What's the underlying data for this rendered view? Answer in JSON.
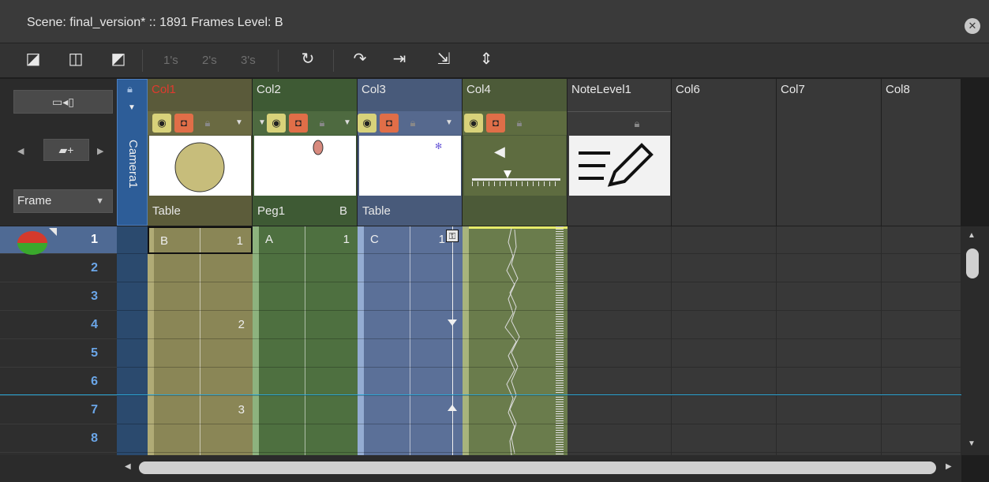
{
  "window": {
    "title": "Scene: final_version*  ::  1891 Frames  Level: B",
    "close_icon": "close-icon"
  },
  "toolbar": {
    "steps": [
      "1's",
      "2's",
      "3's"
    ]
  },
  "left_panel": {
    "frame_mode": "Frame"
  },
  "camera_column": {
    "label": "Camera1"
  },
  "columns": [
    {
      "name": "Col1",
      "name_color": "#e03a2e",
      "footer": "Table",
      "footer_extra": "",
      "color": "#8a8656",
      "head_color": "#5a5a3a",
      "ctrl_bg": "#6a6a42",
      "cells": [
        {
          "row": 1,
          "label": "B",
          "num": "1"
        },
        {
          "row": 4,
          "num": "2"
        },
        {
          "row": 7,
          "num": "3"
        }
      ]
    },
    {
      "name": "Col2",
      "name_color": "#e8e8e8",
      "footer": "Peg1",
      "footer_extra": "B",
      "color": "#4e7040",
      "head_color": "#3e5a34",
      "ctrl_bg": "#4e6a40",
      "cells": [
        {
          "row": 1,
          "label": "A",
          "num": "1"
        }
      ]
    },
    {
      "name": "Col3",
      "name_color": "#e8e8e8",
      "footer": "Table",
      "footer_extra": "",
      "color": "#5b7098",
      "head_color": "#485a7a",
      "ctrl_bg": "#56698e",
      "cells": [
        {
          "row": 1,
          "label": "C",
          "num": "1"
        }
      ]
    },
    {
      "name": "Col4",
      "name_color": "#e8e8e8",
      "footer": "",
      "footer_extra": "",
      "color": "#6a7c4c",
      "head_color": "#4c5a38",
      "ctrl_bg": "#5e6c40",
      "cells": []
    },
    {
      "name": "NoteLevel1",
      "name_color": "#e8e8e8",
      "footer": "",
      "footer_extra": "",
      "color": "#383838",
      "head_color": "#3a3a3a",
      "ctrl_bg": "#3a3a3a",
      "cells": []
    },
    {
      "name": "Col6",
      "name_color": "#e8e8e8"
    },
    {
      "name": "Col7",
      "name_color": "#e8e8e8"
    },
    {
      "name": "Col8",
      "name_color": "#e8e8e8"
    }
  ],
  "rows": [
    "1",
    "2",
    "3",
    "4",
    "5",
    "6",
    "7",
    "8"
  ],
  "current_row": "1"
}
